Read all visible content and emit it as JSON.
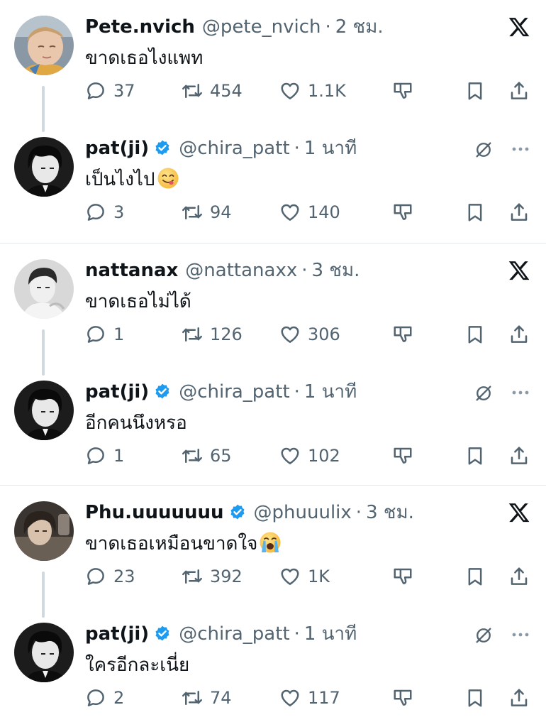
{
  "threads": [
    {
      "original": {
        "display_name": "Pete.nvich",
        "handle": "@pete_nvich",
        "time": "2 ชม.",
        "text": "ขาดเธอไงแพท",
        "emoji": "",
        "replies": "37",
        "reposts": "454",
        "likes": "1.1K",
        "verified": false
      },
      "reply": {
        "display_name": "pat(ji)",
        "handle": "@chira_patt",
        "time": "1 นาที",
        "text": "เป็นไงไป",
        "emoji": "yum-face",
        "replies": "3",
        "reposts": "94",
        "likes": "140",
        "verified": true
      }
    },
    {
      "original": {
        "display_name": "nattanax",
        "handle": "@nattanaxx",
        "time": "3 ชม.",
        "text": "ขาดเธอไม่ได้",
        "emoji": "",
        "replies": "1",
        "reposts": "126",
        "likes": "306",
        "verified": false
      },
      "reply": {
        "display_name": "pat(ji)",
        "handle": "@chira_patt",
        "time": "1 นาที",
        "text": "อีกคนนึงหรอ",
        "emoji": "",
        "replies": "1",
        "reposts": "65",
        "likes": "102",
        "verified": true
      }
    },
    {
      "original": {
        "display_name": "Phu.uuuuuuu",
        "handle": "@phuuulix",
        "time": "3 ชม.",
        "text": "ขาดเธอเหมือนขาดใจ",
        "emoji": "crying-face",
        "replies": "23",
        "reposts": "392",
        "likes": "1K",
        "verified": true
      },
      "reply": {
        "display_name": "pat(ji)",
        "handle": "@chira_patt",
        "time": "1 นาที",
        "text": "ใครอีกละเนี่ย",
        "emoji": "",
        "replies": "2",
        "reposts": "74",
        "likes": "117",
        "verified": true
      }
    }
  ],
  "separator": "·",
  "colors": {
    "text": "#0f1419",
    "secondary": "#536471",
    "verified_blue": "#1d9bf0",
    "divider": "#e6e9ec",
    "thread_line": "#cfd9de"
  }
}
